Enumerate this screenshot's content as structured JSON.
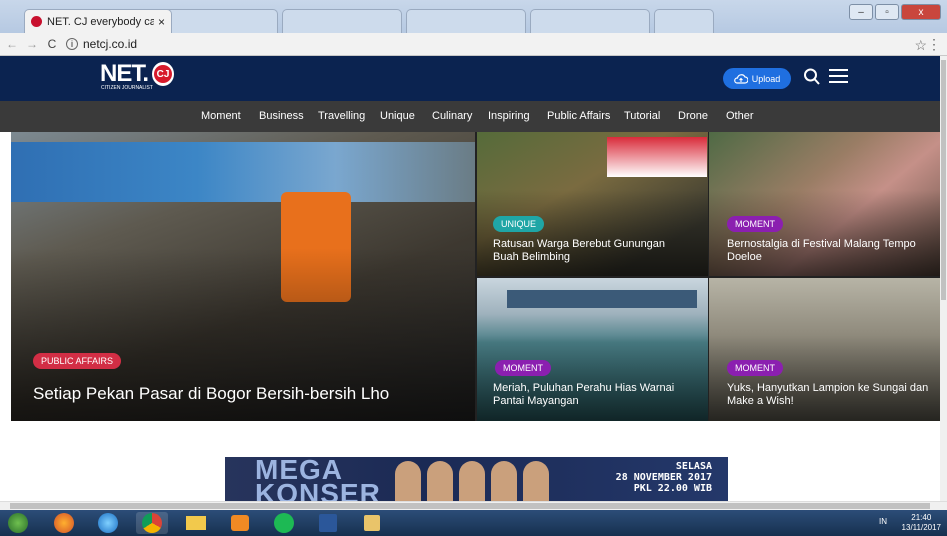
{
  "browser": {
    "active_tab_title": "NET. CJ everybody can b",
    "tab_close": "×",
    "url": "netcj.co.id",
    "info_symbol": "i",
    "back": "←",
    "forward": "→",
    "reload": "C",
    "star": "☆",
    "menu": "⋮",
    "win_min": "‒",
    "win_max": "▫",
    "win_close": "x"
  },
  "header": {
    "logo_text": "NET.",
    "logo_sub": "CITIZEN JOURNALIST",
    "logo_badge": "CJ",
    "upload_label": "Upload",
    "colors": {
      "header_bg": "#0b2350",
      "upload_bg": "#1f6fe0",
      "brand_red": "#d71a2b"
    }
  },
  "nav": {
    "items": [
      "Moment",
      "Business",
      "Travelling",
      "Unique",
      "Culinary",
      "Inspiring",
      "Public Affairs",
      "Tutorial",
      "Drone",
      "Other"
    ]
  },
  "grid": {
    "main": {
      "badge": "PUBLIC AFFAIRS",
      "title": "Setiap Pekan Pasar di Bogor Bersih-bersih Lho"
    },
    "cards": [
      {
        "badge": "UNIQUE",
        "title": "Ratusan Warga Berebut Gunungan Buah Belimbing"
      },
      {
        "badge": "MOMENT",
        "title": "Bernostalgia di Festival Malang Tempo Doeloe"
      },
      {
        "badge": "MOMENT",
        "title": "Meriah, Puluhan Perahu Hias Warnai Pantai Mayangan"
      },
      {
        "badge": "MOMENT",
        "title": "Yuks, Hanyutkan Lampion ke Sungai dan Make a Wish!"
      }
    ]
  },
  "banner": {
    "mega": "MEGA",
    "konser": "KONSER",
    "day": "SELASA",
    "date": "28 NOVEMBER 2017",
    "time": "PKL 22.00 WIB"
  },
  "taskbar": {
    "lang": "IN",
    "time": "21:40",
    "date": "13/11/2017"
  }
}
